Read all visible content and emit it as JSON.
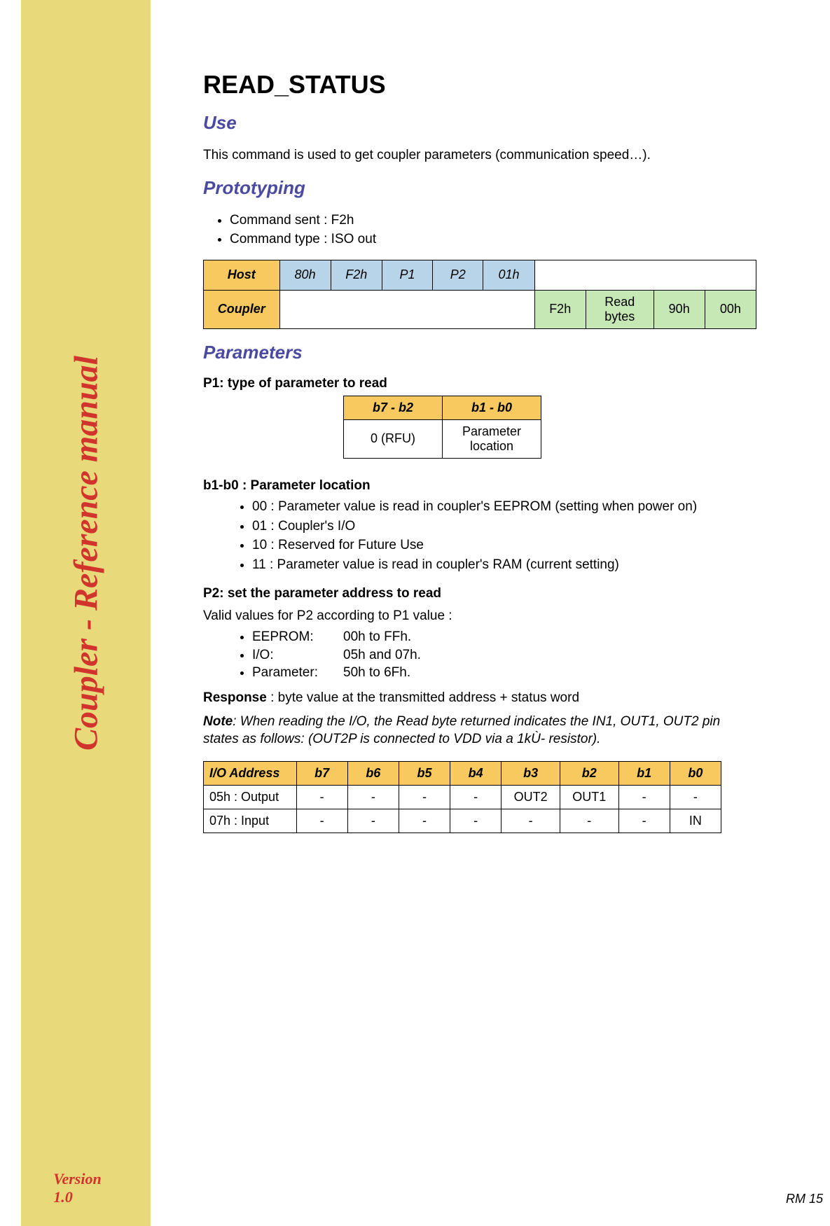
{
  "sidebar": {
    "title": "Coupler - Reference manual",
    "version": "Version 1.0"
  },
  "page": {
    "title": "READ_STATUS",
    "pagenum": "RM 15"
  },
  "use": {
    "heading": "Use",
    "text": "This command is used to get coupler parameters (communication speed…)."
  },
  "proto": {
    "heading": "Prototyping",
    "bullets": [
      "Command sent : F2h",
      "Command type : ISO out"
    ],
    "host_label": "Host",
    "host_cells": [
      "80h",
      "F2h",
      "P1",
      "P2",
      "01h"
    ],
    "coupler_label": "Coupler",
    "coupler_cells": [
      "F2h",
      "Read bytes",
      "90h",
      "00h"
    ]
  },
  "params": {
    "heading": "Parameters",
    "p1_heading": "P1: type of parameter to read",
    "p1_table": {
      "h1": "b7 - b2",
      "h2": "b1 - b0",
      "c1": "0 (RFU)",
      "c2": "Parameter location"
    },
    "loc_heading": "b1-b0 : Parameter location",
    "loc_items": [
      "00 : Parameter value is read in coupler's EEPROM (setting when power on)",
      "01 : Coupler's I/O",
      "10 : Reserved for Future Use",
      "11 : Parameter value is read in coupler's RAM (current setting)"
    ],
    "p2_heading": "P2: set the parameter address to read",
    "p2_intro": "Valid values for P2 according to P1 value :",
    "p2_rows": [
      {
        "k": "EEPROM:",
        "v": "00h to FFh."
      },
      {
        "k": "I/O:",
        "v": "05h and 07h."
      },
      {
        "k": "Parameter:",
        "v": "50h to 6Fh."
      }
    ],
    "response_label": "Response",
    "response_text": " : byte value at the transmitted address + status word",
    "note_label": "Note",
    "note_text": ":  When reading the I/O, the Read byte returned indicates the IN1, OUT1, OUT2 pin states as follows: (OUT2P is connected to VDD via a 1kÙ- resistor)."
  },
  "ioa": {
    "headers": [
      "I/O Address",
      "b7",
      "b6",
      "b5",
      "b4",
      "b3",
      "b2",
      "b1",
      "b0"
    ],
    "rows": [
      {
        "label": "05h : Output",
        "cells": [
          "-",
          "-",
          "-",
          "-",
          "OUT2",
          "OUT1",
          "-",
          "-"
        ]
      },
      {
        "label": "07h : Input",
        "cells": [
          "-",
          "-",
          "-",
          "-",
          "-",
          "-",
          "-",
          "IN"
        ]
      }
    ]
  }
}
